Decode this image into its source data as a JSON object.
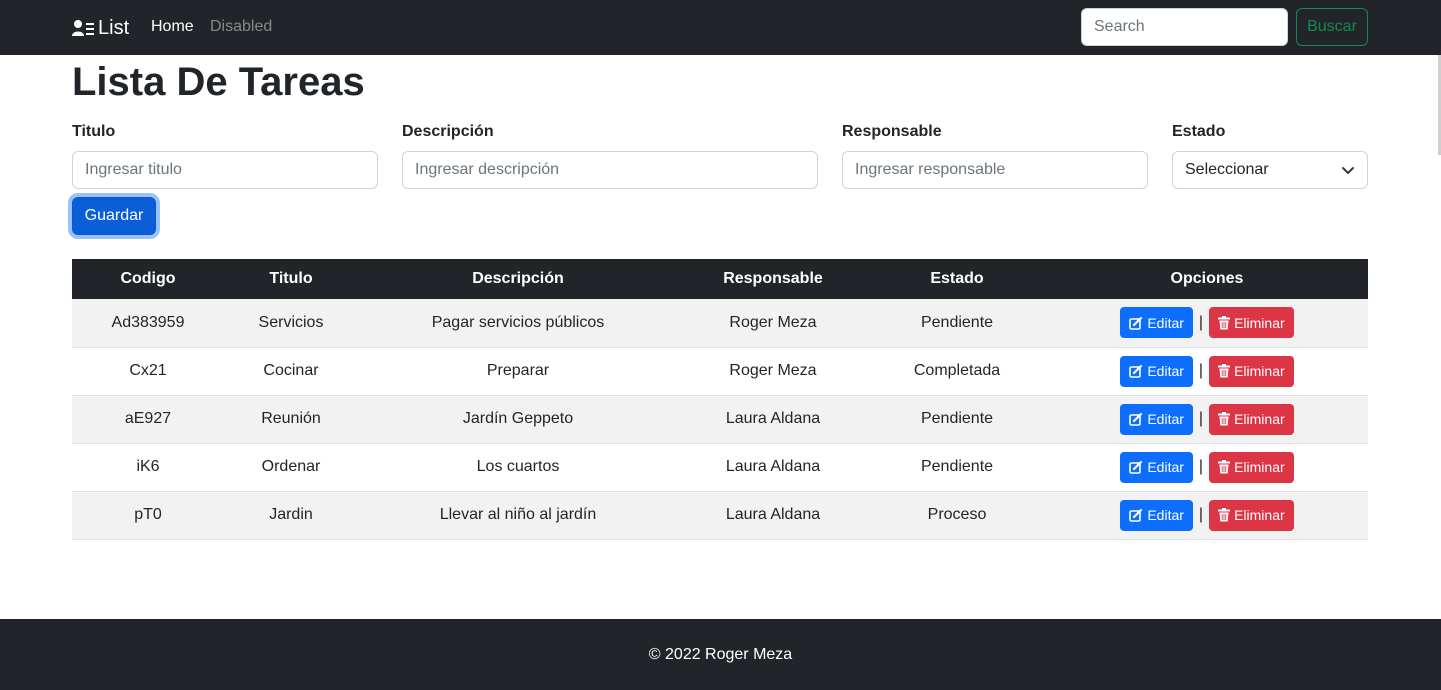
{
  "navbar": {
    "brand": "List",
    "brand_icon": "user-list-icon",
    "links": [
      {
        "label": "Home"
      },
      {
        "label": "Disabled"
      }
    ],
    "search_placeholder": "Search",
    "search_button": "Buscar"
  },
  "page": {
    "title": "Lista De Tareas"
  },
  "form": {
    "titulo": {
      "label": "Titulo",
      "placeholder": "Ingresar titulo"
    },
    "descripcion": {
      "label": "Descripción",
      "placeholder": "Ingresar descripción"
    },
    "responsable": {
      "label": "Responsable",
      "placeholder": "Ingresar responsable"
    },
    "estado": {
      "label": "Estado",
      "selected": "Seleccionar"
    },
    "save_button": "Guardar"
  },
  "table": {
    "headers": [
      "Codigo",
      "Titulo",
      "Descripción",
      "Responsable",
      "Estado",
      "Opciones"
    ],
    "edit_label": "Editar",
    "delete_label": "Eliminar",
    "separator": "|",
    "rows": [
      {
        "codigo": "Ad383959",
        "titulo": "Servicios",
        "descripcion": "Pagar servicios públicos",
        "responsable": "Roger Meza",
        "estado": "Pendiente"
      },
      {
        "codigo": "Cx21",
        "titulo": "Cocinar",
        "descripcion": "Preparar",
        "responsable": "Roger Meza",
        "estado": "Completada"
      },
      {
        "codigo": "aE927",
        "titulo": "Reunión",
        "descripcion": "Jardín Geppeto",
        "responsable": "Laura Aldana",
        "estado": "Pendiente"
      },
      {
        "codigo": "iK6",
        "titulo": "Ordenar",
        "descripcion": "Los cuartos",
        "responsable": "Laura Aldana",
        "estado": "Pendiente"
      },
      {
        "codigo": "pT0",
        "titulo": "Jardin",
        "descripcion": "Llevar al niño al jardín",
        "responsable": "Laura Aldana",
        "estado": "Proceso"
      }
    ]
  },
  "footer": {
    "text": "© 2022 Roger Meza"
  },
  "colors": {
    "navbar_bg": "#212529",
    "primary": "#0d6efd",
    "danger": "#dc3545",
    "success": "#198754"
  }
}
